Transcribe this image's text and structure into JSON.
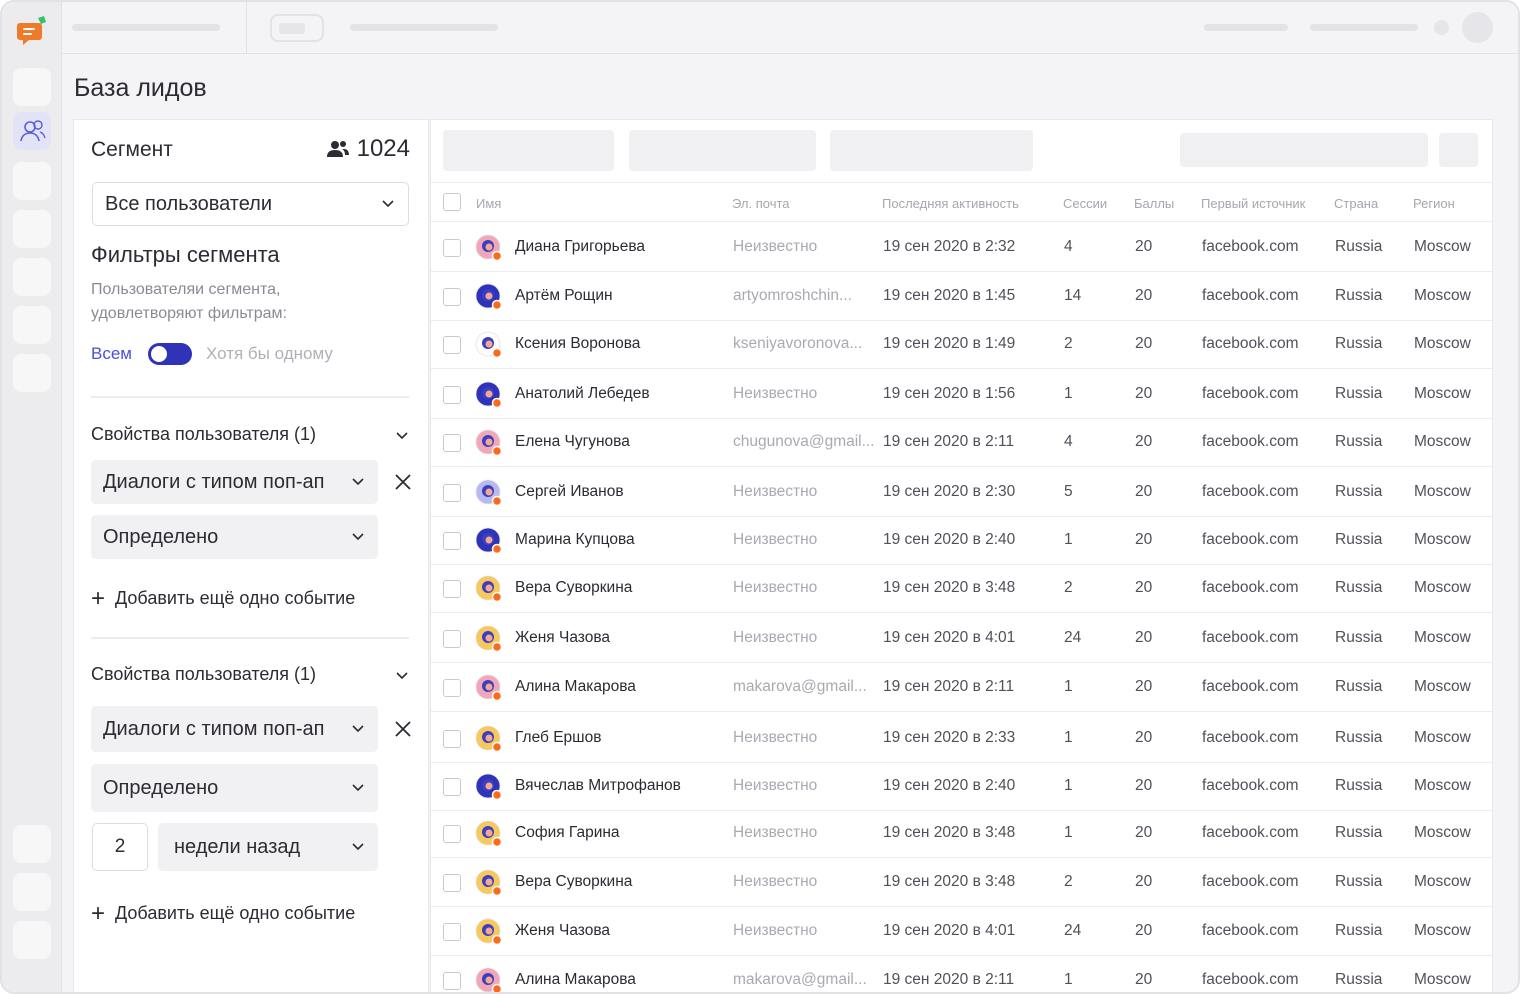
{
  "page": {
    "title": "База лидов"
  },
  "segment": {
    "title": "Сегмент",
    "count": "1024",
    "select_value": "Все пользователи",
    "filters_title": "Фильтры сегмента",
    "filters_desc": "Пользователяи сегмента, удовлетворяют фильтрам:",
    "mode_all": "Всем",
    "mode_any": "Хотя бы одному",
    "groups": [
      {
        "title": "Свойства пользователя (1)",
        "event_select": "Диалоги с типом поп-ап",
        "condition_select": "Определено",
        "add_label": "Добавить ещё одно событие"
      },
      {
        "title": "Свойства пользователя (1)",
        "event_select": "Диалоги с типом поп-ап",
        "condition_select": "Определено",
        "number_value": "2",
        "period_select": "недели назад",
        "add_label": "Добавить ещё одно событие"
      }
    ]
  },
  "table": {
    "columns": [
      "Имя",
      "Эл. почта",
      "Последняя активность",
      "Сессии",
      "Баллы",
      "Первый источник",
      "Страна",
      "Регион"
    ],
    "rows": [
      {
        "name": "Диана Григорьева",
        "email": "Неизвестно",
        "email_known": false,
        "activity": "19 сен 2020 в 2:32",
        "sessions": "4",
        "score": "20",
        "source": "facebook.com",
        "country": "Russia",
        "region": "Moscow",
        "avatar_color": "#f2a7b8"
      },
      {
        "name": "Артём Рощин",
        "email": "artyomroshchin...",
        "email_known": true,
        "activity": "19 сен 2020 в 1:45",
        "sessions": "14",
        "score": "20",
        "source": "facebook.com",
        "country": "Russia",
        "region": "Moscow",
        "avatar_color": "#2f33b8"
      },
      {
        "name": "Ксения Воронова",
        "email": "kseniyavoronova...",
        "email_known": true,
        "activity": "19 сен 2020 в 1:49",
        "sessions": "2",
        "score": "20",
        "source": "facebook.com",
        "country": "Russia",
        "region": "Moscow",
        "avatar_color": "#ffffff"
      },
      {
        "name": "Анатолий Лебедев",
        "email": "Неизвестно",
        "email_known": false,
        "activity": "19 сен 2020 в 1:56",
        "sessions": "1",
        "score": "20",
        "source": "facebook.com",
        "country": "Russia",
        "region": "Moscow",
        "avatar_color": "#2f33b8"
      },
      {
        "name": "Елена Чугунова",
        "email": "chugunova@gmail...",
        "email_known": true,
        "activity": "19 сен 2020 в 2:11",
        "sessions": "4",
        "score": "20",
        "source": "facebook.com",
        "country": "Russia",
        "region": "Moscow",
        "avatar_color": "#f2a7b8"
      },
      {
        "name": "Сергей Иванов",
        "email": "Неизвестно",
        "email_known": false,
        "activity": "19 сен 2020 в 2:30",
        "sessions": "5",
        "score": "20",
        "source": "facebook.com",
        "country": "Russia",
        "region": "Moscow",
        "avatar_color": "#b8b9f0"
      },
      {
        "name": "Марина Купцова",
        "email": "Неизвестно",
        "email_known": false,
        "activity": "19 сен 2020 в 2:40",
        "sessions": "1",
        "score": "20",
        "source": "facebook.com",
        "country": "Russia",
        "region": "Moscow",
        "avatar_color": "#2f33b8"
      },
      {
        "name": "Вера Суворкина",
        "email": "Неизвестно",
        "email_known": false,
        "activity": "19 сен 2020 в 3:48",
        "sessions": "2",
        "score": "20",
        "source": "facebook.com",
        "country": "Russia",
        "region": "Moscow",
        "avatar_color": "#f7c85a"
      },
      {
        "name": "Женя Чазова",
        "email": "Неизвестно",
        "email_known": false,
        "activity": "19 сен 2020 в 4:01",
        "sessions": "24",
        "score": "20",
        "source": "facebook.com",
        "country": "Russia",
        "region": "Moscow",
        "avatar_color": "#f7c85a"
      },
      {
        "name": "Алина Макарова",
        "email": "makarova@gmail...",
        "email_known": true,
        "activity": "19 сен 2020 в 2:11",
        "sessions": "1",
        "score": "20",
        "source": "facebook.com",
        "country": "Russia",
        "region": "Moscow",
        "avatar_color": "#f2a7b8"
      },
      {
        "name": "Глеб Ершов",
        "email": "Неизвестно",
        "email_known": false,
        "activity": "19 сен 2020 в 2:33",
        "sessions": "1",
        "score": "20",
        "source": "facebook.com",
        "country": "Russia",
        "region": "Moscow",
        "avatar_color": "#f7c85a"
      },
      {
        "name": "Вячеслав Митрофанов",
        "email": "Неизвестно",
        "email_known": false,
        "activity": "19 сен 2020 в 2:40",
        "sessions": "1",
        "score": "20",
        "source": "facebook.com",
        "country": "Russia",
        "region": "Moscow",
        "avatar_color": "#2f33b8"
      },
      {
        "name": "София Гарина",
        "email": "Неизвестно",
        "email_known": false,
        "activity": "19 сен 2020 в 3:48",
        "sessions": "1",
        "score": "20",
        "source": "facebook.com",
        "country": "Russia",
        "region": "Moscow",
        "avatar_color": "#f7c85a"
      },
      {
        "name": "Вера Суворкина",
        "email": "Неизвестно",
        "email_known": false,
        "activity": "19 сен 2020 в 3:48",
        "sessions": "2",
        "score": "20",
        "source": "facebook.com",
        "country": "Russia",
        "region": "Moscow",
        "avatar_color": "#f7c85a"
      },
      {
        "name": "Женя Чазова",
        "email": "Неизвестно",
        "email_known": false,
        "activity": "19 сен 2020 в 4:01",
        "sessions": "24",
        "score": "20",
        "source": "facebook.com",
        "country": "Russia",
        "region": "Moscow",
        "avatar_color": "#f7c85a"
      },
      {
        "name": "Алина Макарова",
        "email": "makarova@gmail...",
        "email_known": true,
        "activity": "19 сен 2020 в 2:11",
        "sessions": "1",
        "score": "20",
        "source": "facebook.com",
        "country": "Russia",
        "region": "Moscow",
        "avatar_color": "#f2a7b8"
      }
    ]
  },
  "colors": {
    "accent": "#2f33b8",
    "accent_text": "#4b4fd8",
    "status_dot": "#ff6a1a",
    "logo": "#f07a2a"
  },
  "icons": {
    "logo": "chat-bubble-logo-icon",
    "users": "users-icon",
    "chevron": "chevron-down-icon",
    "close": "close-icon",
    "plus": "plus-icon"
  }
}
